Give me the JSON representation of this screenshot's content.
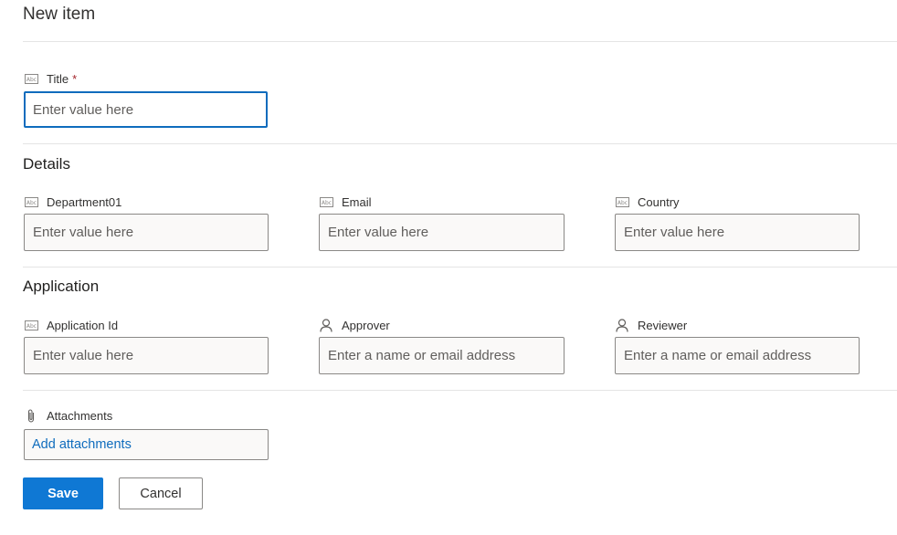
{
  "form": {
    "title": "New item",
    "title_field": {
      "label": "Title",
      "required_mark": "*",
      "placeholder": "Enter value here",
      "icon": "text-field-icon"
    },
    "sections": {
      "details": {
        "title": "Details",
        "fields": [
          {
            "label": "Department01",
            "placeholder": "Enter value here",
            "icon": "text-field-icon"
          },
          {
            "label": "Email",
            "placeholder": "Enter value here",
            "icon": "text-field-icon"
          },
          {
            "label": "Country",
            "placeholder": "Enter value here",
            "icon": "text-field-icon"
          }
        ]
      },
      "application": {
        "title": "Application",
        "fields": [
          {
            "label": "Application Id",
            "placeholder": "Enter value here",
            "icon": "text-field-icon"
          },
          {
            "label": "Approver",
            "placeholder": "Enter a name or email address",
            "icon": "person-icon"
          },
          {
            "label": "Reviewer",
            "placeholder": "Enter a name or email address",
            "icon": "person-icon"
          }
        ]
      }
    },
    "attachments": {
      "label": "Attachments",
      "link": "Add attachments",
      "icon": "paperclip-icon"
    },
    "buttons": {
      "save": "Save",
      "cancel": "Cancel"
    }
  },
  "colors": {
    "accent": "#0f78d4",
    "focus_border": "#0f6cbd",
    "required": "#a4262c"
  }
}
